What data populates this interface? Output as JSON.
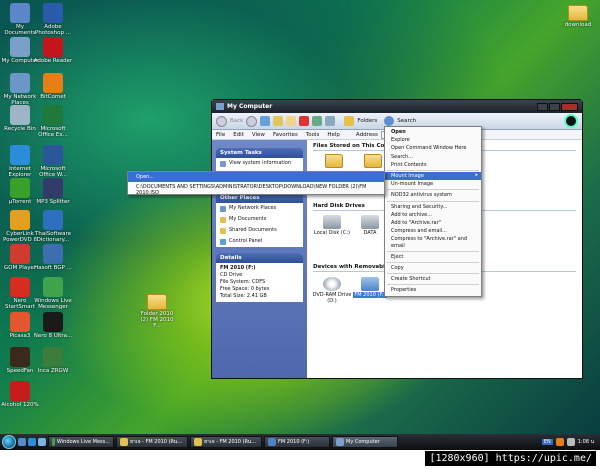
{
  "desktop": {
    "icons": [
      {
        "label": "My Documents",
        "icon": "documents-folder-icon",
        "color": "#5b86c9"
      },
      {
        "label": "Adobe Photoshop ...",
        "icon": "photoshop-icon",
        "color": "#2b5cab"
      },
      {
        "label": "My Computer",
        "icon": "computer-icon",
        "color": "#7aa0c9"
      },
      {
        "label": "Adobe Reader",
        "icon": "adobe-reader-icon",
        "color": "#c4161c"
      },
      {
        "label": "My Network Places",
        "icon": "network-icon",
        "color": "#6c96c8"
      },
      {
        "label": "BitComet",
        "icon": "bitcomet-icon",
        "color": "#e77f16"
      },
      {
        "label": "Recycle Bin",
        "icon": "recycle-bin-icon",
        "color": "#9fb5c7"
      },
      {
        "label": "Microsoft Office Ex...",
        "icon": "excel-icon",
        "color": "#1f7a3a"
      },
      {
        "label": "Internet Explorer",
        "icon": "internet-explorer-icon",
        "color": "#2b8cd8"
      },
      {
        "label": "Microsoft Office W...",
        "icon": "word-icon",
        "color": "#2b579a"
      },
      {
        "label": "µTorrent",
        "icon": "utorrent-icon",
        "color": "#3aa02a"
      },
      {
        "label": "MP3 Splitter",
        "icon": "mp3-splitter-icon",
        "color": "#333b6b"
      },
      {
        "label": "CyberLink PowerDVD 8",
        "icon": "powerdvd-icon",
        "color": "#e3a020"
      },
      {
        "label": "ThaiSoftware Dictionary...",
        "icon": "dictionary-icon",
        "color": "#2f6fc0"
      },
      {
        "label": "GOM Player",
        "icon": "gom-player-icon",
        "color": "#d13b2f"
      },
      {
        "label": "Hasoft BGP ...",
        "icon": "hasoft-icon",
        "color": "#3d6fb0"
      },
      {
        "label": "Nero StartSmart",
        "icon": "nero-icon",
        "color": "#d62d20"
      },
      {
        "label": "Windows Live Messenger",
        "icon": "messenger-icon",
        "color": "#3ea34a"
      },
      {
        "label": "Picasa3",
        "icon": "picasa-icon",
        "color": "#e4572e"
      },
      {
        "label": "Nero 8 Ultra...",
        "icon": "nero-10-icon",
        "color": "#1a1a1a"
      },
      {
        "label": "SpeedFan",
        "icon": "speedfan-icon",
        "color": "#3b2a1c"
      },
      {
        "label": "Inca ZRGW",
        "icon": "inca-icon",
        "color": "#3b7d3b"
      },
      {
        "label": "Alcohol 120%",
        "icon": "alcohol-icon",
        "color": "#c71c1c"
      }
    ],
    "folder_right": {
      "label": "download"
    },
    "folder_mid": {
      "label": "Folder 2010 (2) FM 2010 F..."
    }
  },
  "window": {
    "title": "My Computer",
    "toolbar": {
      "back": "Back",
      "folders": "Folders",
      "search": "Search"
    },
    "menu": [
      "File",
      "Edit",
      "View",
      "Favorites",
      "Tools",
      "Help"
    ],
    "address_label": "Address",
    "system_tasks": {
      "title": "System Tasks",
      "items": [
        "View system information"
      ]
    },
    "other_places": {
      "title": "Other Places",
      "items": [
        "My Network Places",
        "My Documents",
        "Shared Documents",
        "Control Panel"
      ]
    },
    "details": {
      "title": "Details",
      "name": "FM 2010 (F:)",
      "type": "CD Drive",
      "fs": "File System: CDFS",
      "free": "Free Space: 0 bytes",
      "total": "Total Size: 2.41 GB"
    },
    "groups": {
      "files": "Files Stored on This Com",
      "hdd": "Hard Disk Drives",
      "removable": "Devices with Removable"
    },
    "drives": {
      "local_c": "Local Disk (C:)",
      "data": "DATA",
      "dvd": "DVD-RAM Drive (D:)",
      "fm": "FM 2010 (F:)"
    }
  },
  "context_menu": {
    "items": [
      {
        "label": "Open",
        "bold": true
      },
      {
        "label": "Explore"
      },
      {
        "label": "Open Command Window Here"
      },
      {
        "label": "Search..."
      },
      {
        "label": "Print Contents"
      },
      {
        "sep": true
      },
      {
        "label": "Mount Image",
        "highlight": true
      },
      {
        "label": "Un-mount Image"
      },
      {
        "sep": true
      },
      {
        "label": "NOD32 antivirus system"
      },
      {
        "sep": true
      },
      {
        "label": "Sharing and Security..."
      },
      {
        "label": "Add to archive..."
      },
      {
        "label": "Add to \"Archive.rar\""
      },
      {
        "label": "Compress and email..."
      },
      {
        "label": "Compress to \"Archive.rar\" and email"
      },
      {
        "sep": true
      },
      {
        "label": "Eject"
      },
      {
        "sep": true
      },
      {
        "label": "Copy"
      },
      {
        "sep": true
      },
      {
        "label": "Create Shortcut"
      },
      {
        "sep": true
      },
      {
        "label": "Properties"
      }
    ]
  },
  "submenu": {
    "open": "Open...",
    "path": "C:\\DOCUMENTS AND SETTINGS\\ADMINISTRATOR\\DESKTOP\\DOWNLOAD\\NEW FOLDER (2)\\FM 2010.ISO"
  },
  "taskbar": {
    "tasks": [
      "Windows Live Mess...",
      "ฮาเจ - FM 2010 (ดิน...",
      "ฮาเจ - FM 2010 (ดิน...",
      "FM 2010 (F:)",
      "My Computer"
    ],
    "lang": "EN",
    "clock": "1:08 น"
  },
  "watermark": "[1280x960] https://upic.me/"
}
